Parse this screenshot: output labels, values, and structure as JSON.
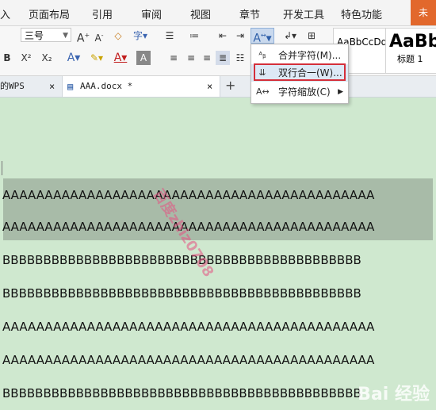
{
  "menubar": {
    "items": [
      "入",
      "页面布局",
      "引用",
      "审阅",
      "视图",
      "章节",
      "开发工具",
      "特色功能"
    ],
    "right_tab": "未"
  },
  "ribbon": {
    "font_size": "三号",
    "bold_fragment": "B",
    "style_preview_1": "AaBbCcDd",
    "style_preview_2": "AaBb",
    "style_label_2": "标题 1"
  },
  "dropdown": {
    "items": [
      {
        "label": "合并字符(M)...",
        "icon": "combine-chars-icon"
      },
      {
        "label": "双行合一(W)...",
        "icon": "two-lines-in-one-icon"
      },
      {
        "label": "字符缩放(C)",
        "icon": "char-scale-icon",
        "has_submenu": true
      }
    ]
  },
  "tabs": [
    {
      "label": "的WPS"
    },
    {
      "label": "AAA.docx *"
    }
  ],
  "document": {
    "lines": [
      "AAAAAAAAAAAAAAAAAAAAAAAAAAAAAAAAAAAAAAAAAAAA",
      "AAAAAAAAAAAAAAAAAAAAAAAAAAAAAAAAAAAAAAAAAAAA",
      "BBBBBBBBBBBBBBBBBBBBBBBBBBBBBBBBBBBBBBBBBBBB",
      "BBBBBBBBBBBBBBBBBBBBBBBBBBBBBBBBBBBBBBBBBBBB",
      "AAAAAAAAAAAAAAAAAAAAAAAAAAAAAAAAAAAAAAAAAAAA",
      "AAAAAAAAAAAAAAAAAAAAAAAAAAAAAAAAAAAAAAAAAAAA",
      "BBBBBBBBBBBBBBBBBBBBBBBBBBBBBBBBBBBBBBBBBBBB"
    ],
    "watermark": "百度zhiz0708",
    "baidu_mark": "Bai 经验"
  },
  "colors": {
    "highlight_border": "#d42f3a",
    "doc_bg": "#cfe8cf",
    "selection": "#a8bba8"
  }
}
